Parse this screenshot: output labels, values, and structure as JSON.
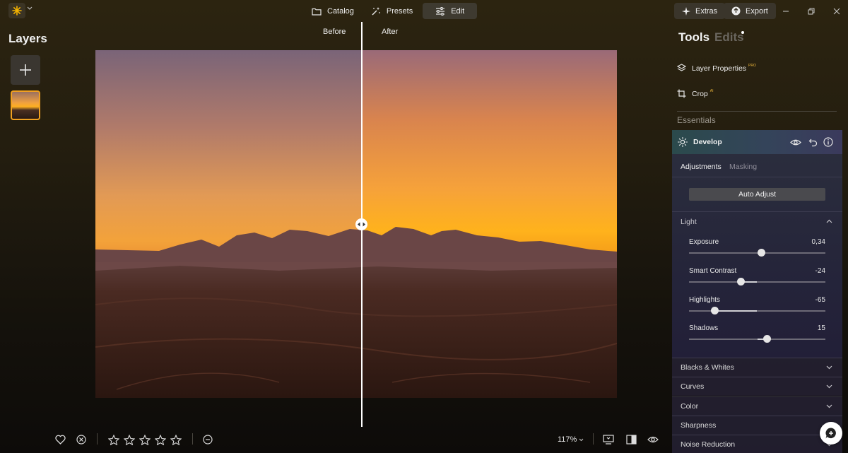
{
  "nav": {
    "catalog": "Catalog",
    "presets": "Presets",
    "edit": "Edit",
    "active": "Edit"
  },
  "top_right": {
    "extras": "Extras",
    "export": "Export"
  },
  "layers": {
    "title": "Layers"
  },
  "compare": {
    "before": "Before",
    "after": "After"
  },
  "bottom": {
    "zoom": "117%",
    "stars": 5
  },
  "panel": {
    "tools_tab": "Tools",
    "edits_tab": "Edits",
    "tools": [
      {
        "label": "Layer Properties",
        "badge": "PRO",
        "icon": "layers-icon"
      },
      {
        "label": "Crop",
        "badge": "AI",
        "icon": "crop-icon"
      }
    ],
    "essentials": "Essentials",
    "develop": {
      "title": "Develop",
      "tab_adjustments": "Adjustments",
      "tab_masking": "Masking",
      "auto_adjust": "Auto Adjust",
      "light": "Light",
      "sliders": [
        {
          "label": "Exposure",
          "value": "0,34",
          "fraction": 0.53
        },
        {
          "label": "Smart Contrast",
          "value": "-24",
          "fraction": 0.38
        },
        {
          "label": "Highlights",
          "value": "-65",
          "fraction": 0.19
        },
        {
          "label": "Shadows",
          "value": "15",
          "fraction": 0.57
        }
      ]
    },
    "sections": [
      "Blacks & Whites",
      "Curves",
      "Color",
      "Sharpness",
      "Noise Reduction"
    ]
  },
  "colors": {
    "accent": "#f0a020",
    "brand_icon": "#f5b400"
  }
}
